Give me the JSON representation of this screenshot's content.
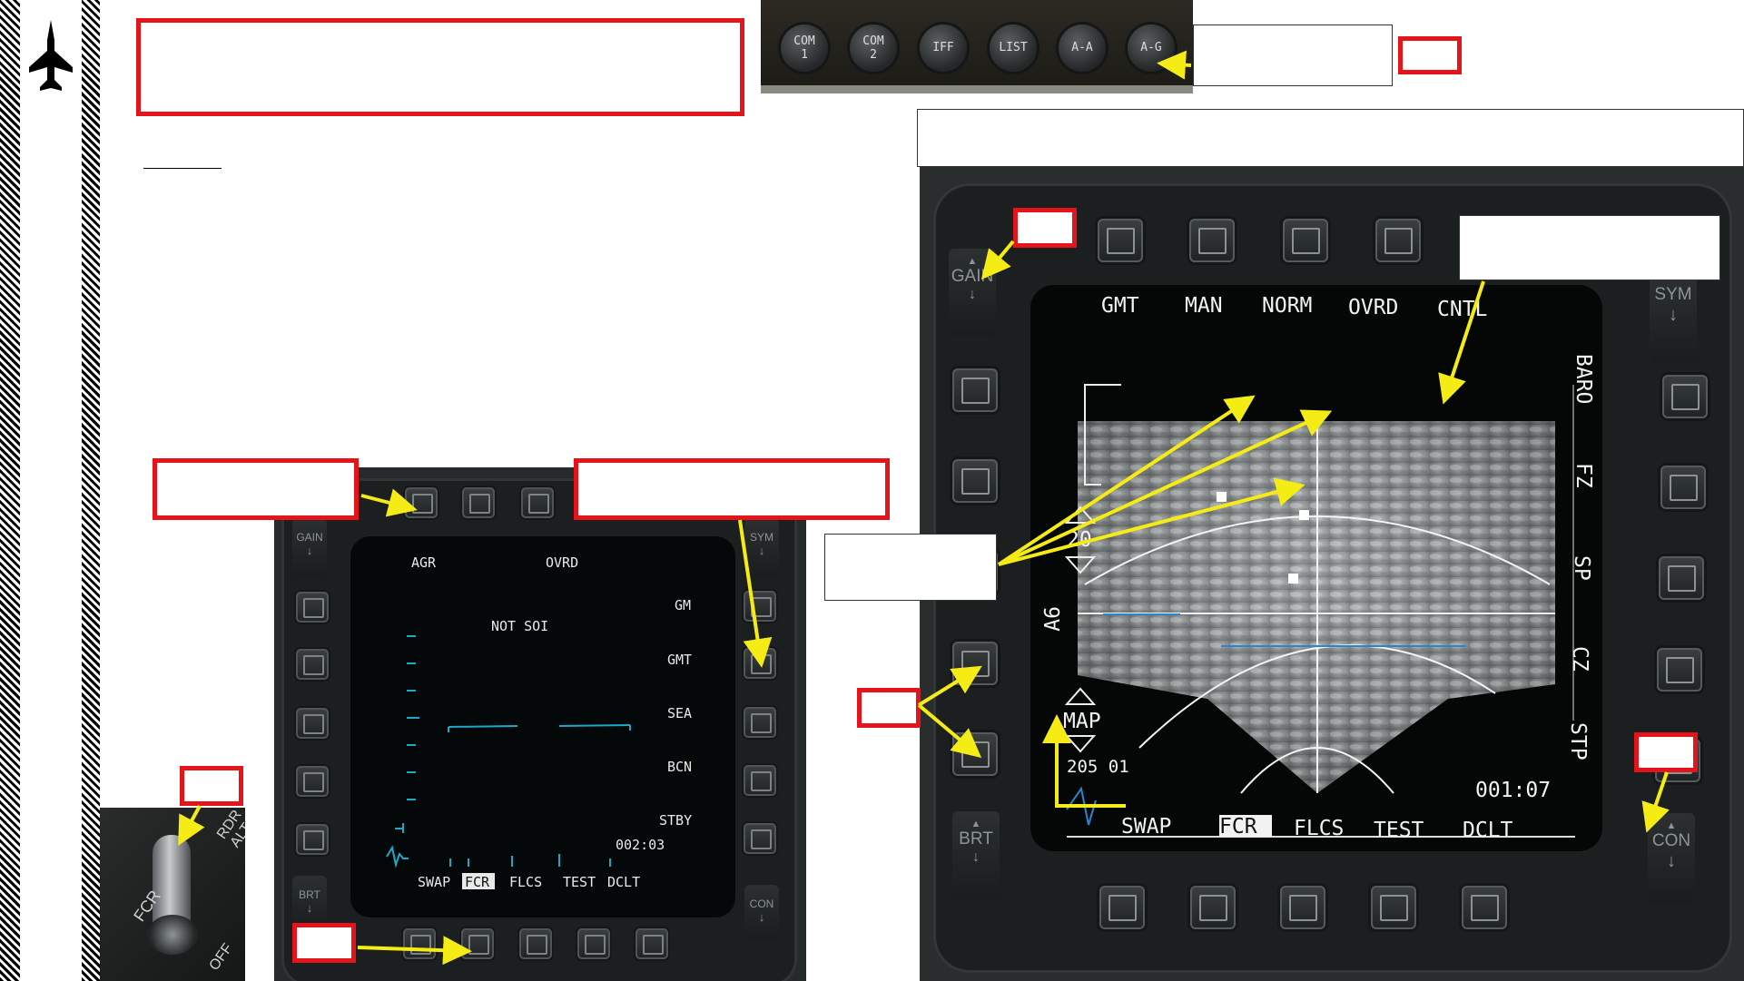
{
  "left_mfd": {
    "top_labels": [
      "AGR",
      "OVRD"
    ],
    "center_text": "NOT SOI",
    "right_labels": [
      "GM",
      "GMT",
      "SEA",
      "BCN",
      "STBY"
    ],
    "timer": "002:03",
    "bottom_labels": [
      "SWAP",
      "FCR",
      "FLCS",
      "TEST",
      "DCLT"
    ],
    "rocker_gain": "GAIN",
    "rocker_sym": "SYM",
    "rocker_brt": "BRT",
    "rocker_con": "CON"
  },
  "right_mfd": {
    "top_labels": [
      "GMT",
      "MAN",
      "NORM",
      "OVRD",
      "CNTL"
    ],
    "right_vertical": [
      "BARO",
      "FZ",
      "SP",
      "CZ",
      "STP"
    ],
    "range_value": "20",
    "azimuth_value": "A6",
    "map_label": "MAP",
    "bottom_left_value": "205 01",
    "timer": "001:07",
    "bottom_labels": [
      "SWAP",
      "FCR",
      "FLCS",
      "TEST",
      "DCLT"
    ],
    "rocker_gain": "GAIN",
    "rocker_sym": "SYM",
    "rocker_brt": "BRT",
    "rocker_con": "CON"
  },
  "icp_buttons": [
    {
      "line1": "COM",
      "line2": "1"
    },
    {
      "line1": "COM",
      "line2": "2"
    },
    {
      "line1": "IFF",
      "line2": ""
    },
    {
      "line1": "LIST",
      "line2": ""
    },
    {
      "line1": "A-A",
      "line2": ""
    },
    {
      "line1": "A-G",
      "line2": ""
    }
  ],
  "switch_labels": {
    "fcr": "FCR",
    "rdr": "RDR",
    "alt": "ALT",
    "off": "OFF"
  },
  "colors": {
    "accent_red": "#e5141b",
    "arrow_yellow": "#f5ec16",
    "mfd_cyan": "#19a9c9"
  },
  "icons": {
    "aircraft": "jet-silhouette-icon"
  }
}
